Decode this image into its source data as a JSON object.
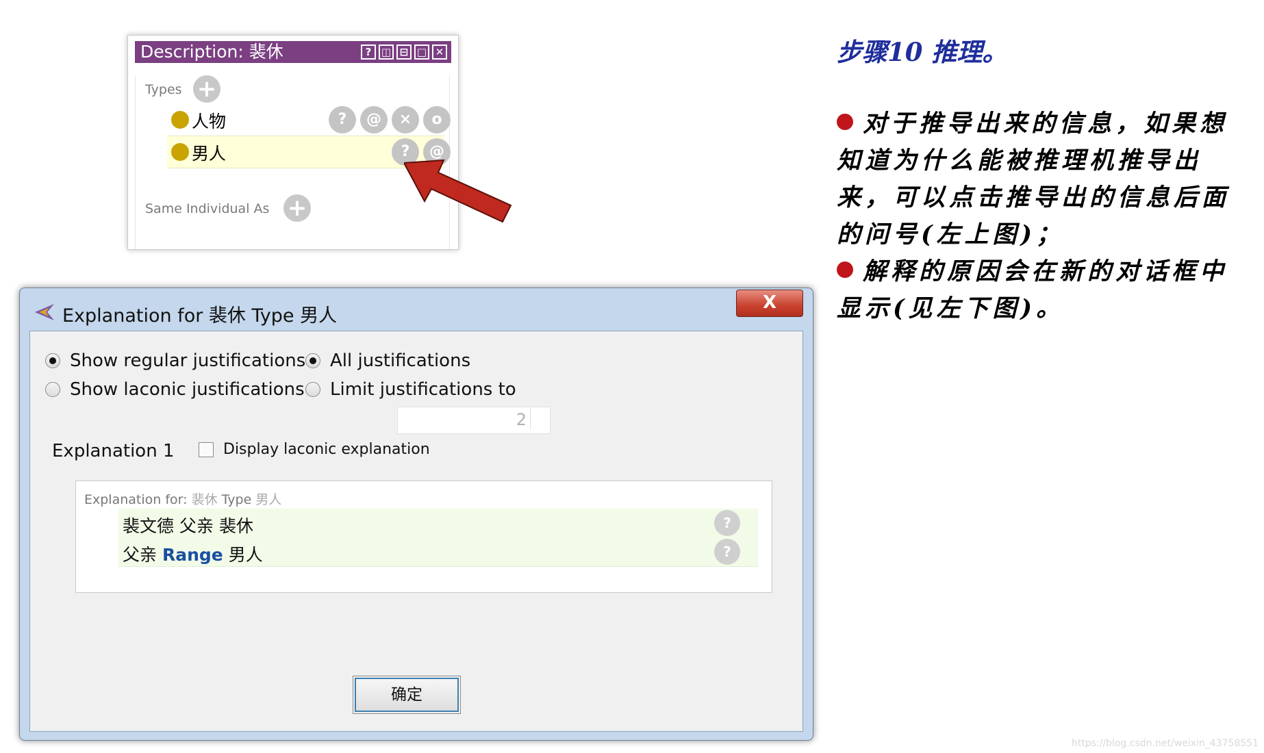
{
  "description_panel": {
    "title": "Description: 裴休",
    "window_buttons": [
      "?",
      "◫",
      "⊟",
      "□",
      "✕"
    ],
    "types_label": "Types",
    "types": [
      {
        "label": "人物",
        "buttons": [
          "?",
          "@",
          "×",
          "o"
        ]
      },
      {
        "label": "男人",
        "buttons": [
          "?",
          "@"
        ]
      }
    ],
    "same_individual_label": "Same Individual As"
  },
  "right_text": {
    "heading": "步骤10 推理。",
    "para1": "对于推导出来的信息，如果想知道为什么能被推理机推导出来，可以点击推导出的信息后面的问号(左上图)；",
    "para2": "解释的原因会在新的对话框中显示(见左下图)。",
    "bullet_color": "#c0151b"
  },
  "dialog": {
    "title": "Explanation for 裴休 Type 男人",
    "close_label": "X",
    "options": {
      "show_regular": "Show regular justifications",
      "show_laconic": "Show laconic justifications",
      "all_justifications": "All justifications",
      "limit_justifications": "Limit justifications to",
      "limit_value": "2",
      "selected_left": "show_regular",
      "selected_right": "all_justifications"
    },
    "explanation_label": "Explanation 1",
    "display_laconic_label": "Display laconic explanation",
    "display_laconic_checked": false,
    "explanation_for_prefix": "Explanation for:",
    "explanation_for_subject": "裴休",
    "explanation_for_type": "Type",
    "explanation_for_object": "男人",
    "axioms": [
      {
        "subject": "裴文德",
        "keyword": "父亲",
        "object": "裴休"
      },
      {
        "subject": "父亲",
        "keyword": "Range",
        "object": "男人"
      }
    ],
    "ok_label": "确定"
  },
  "watermark": "https://blog.csdn.net/weixin_43758551"
}
